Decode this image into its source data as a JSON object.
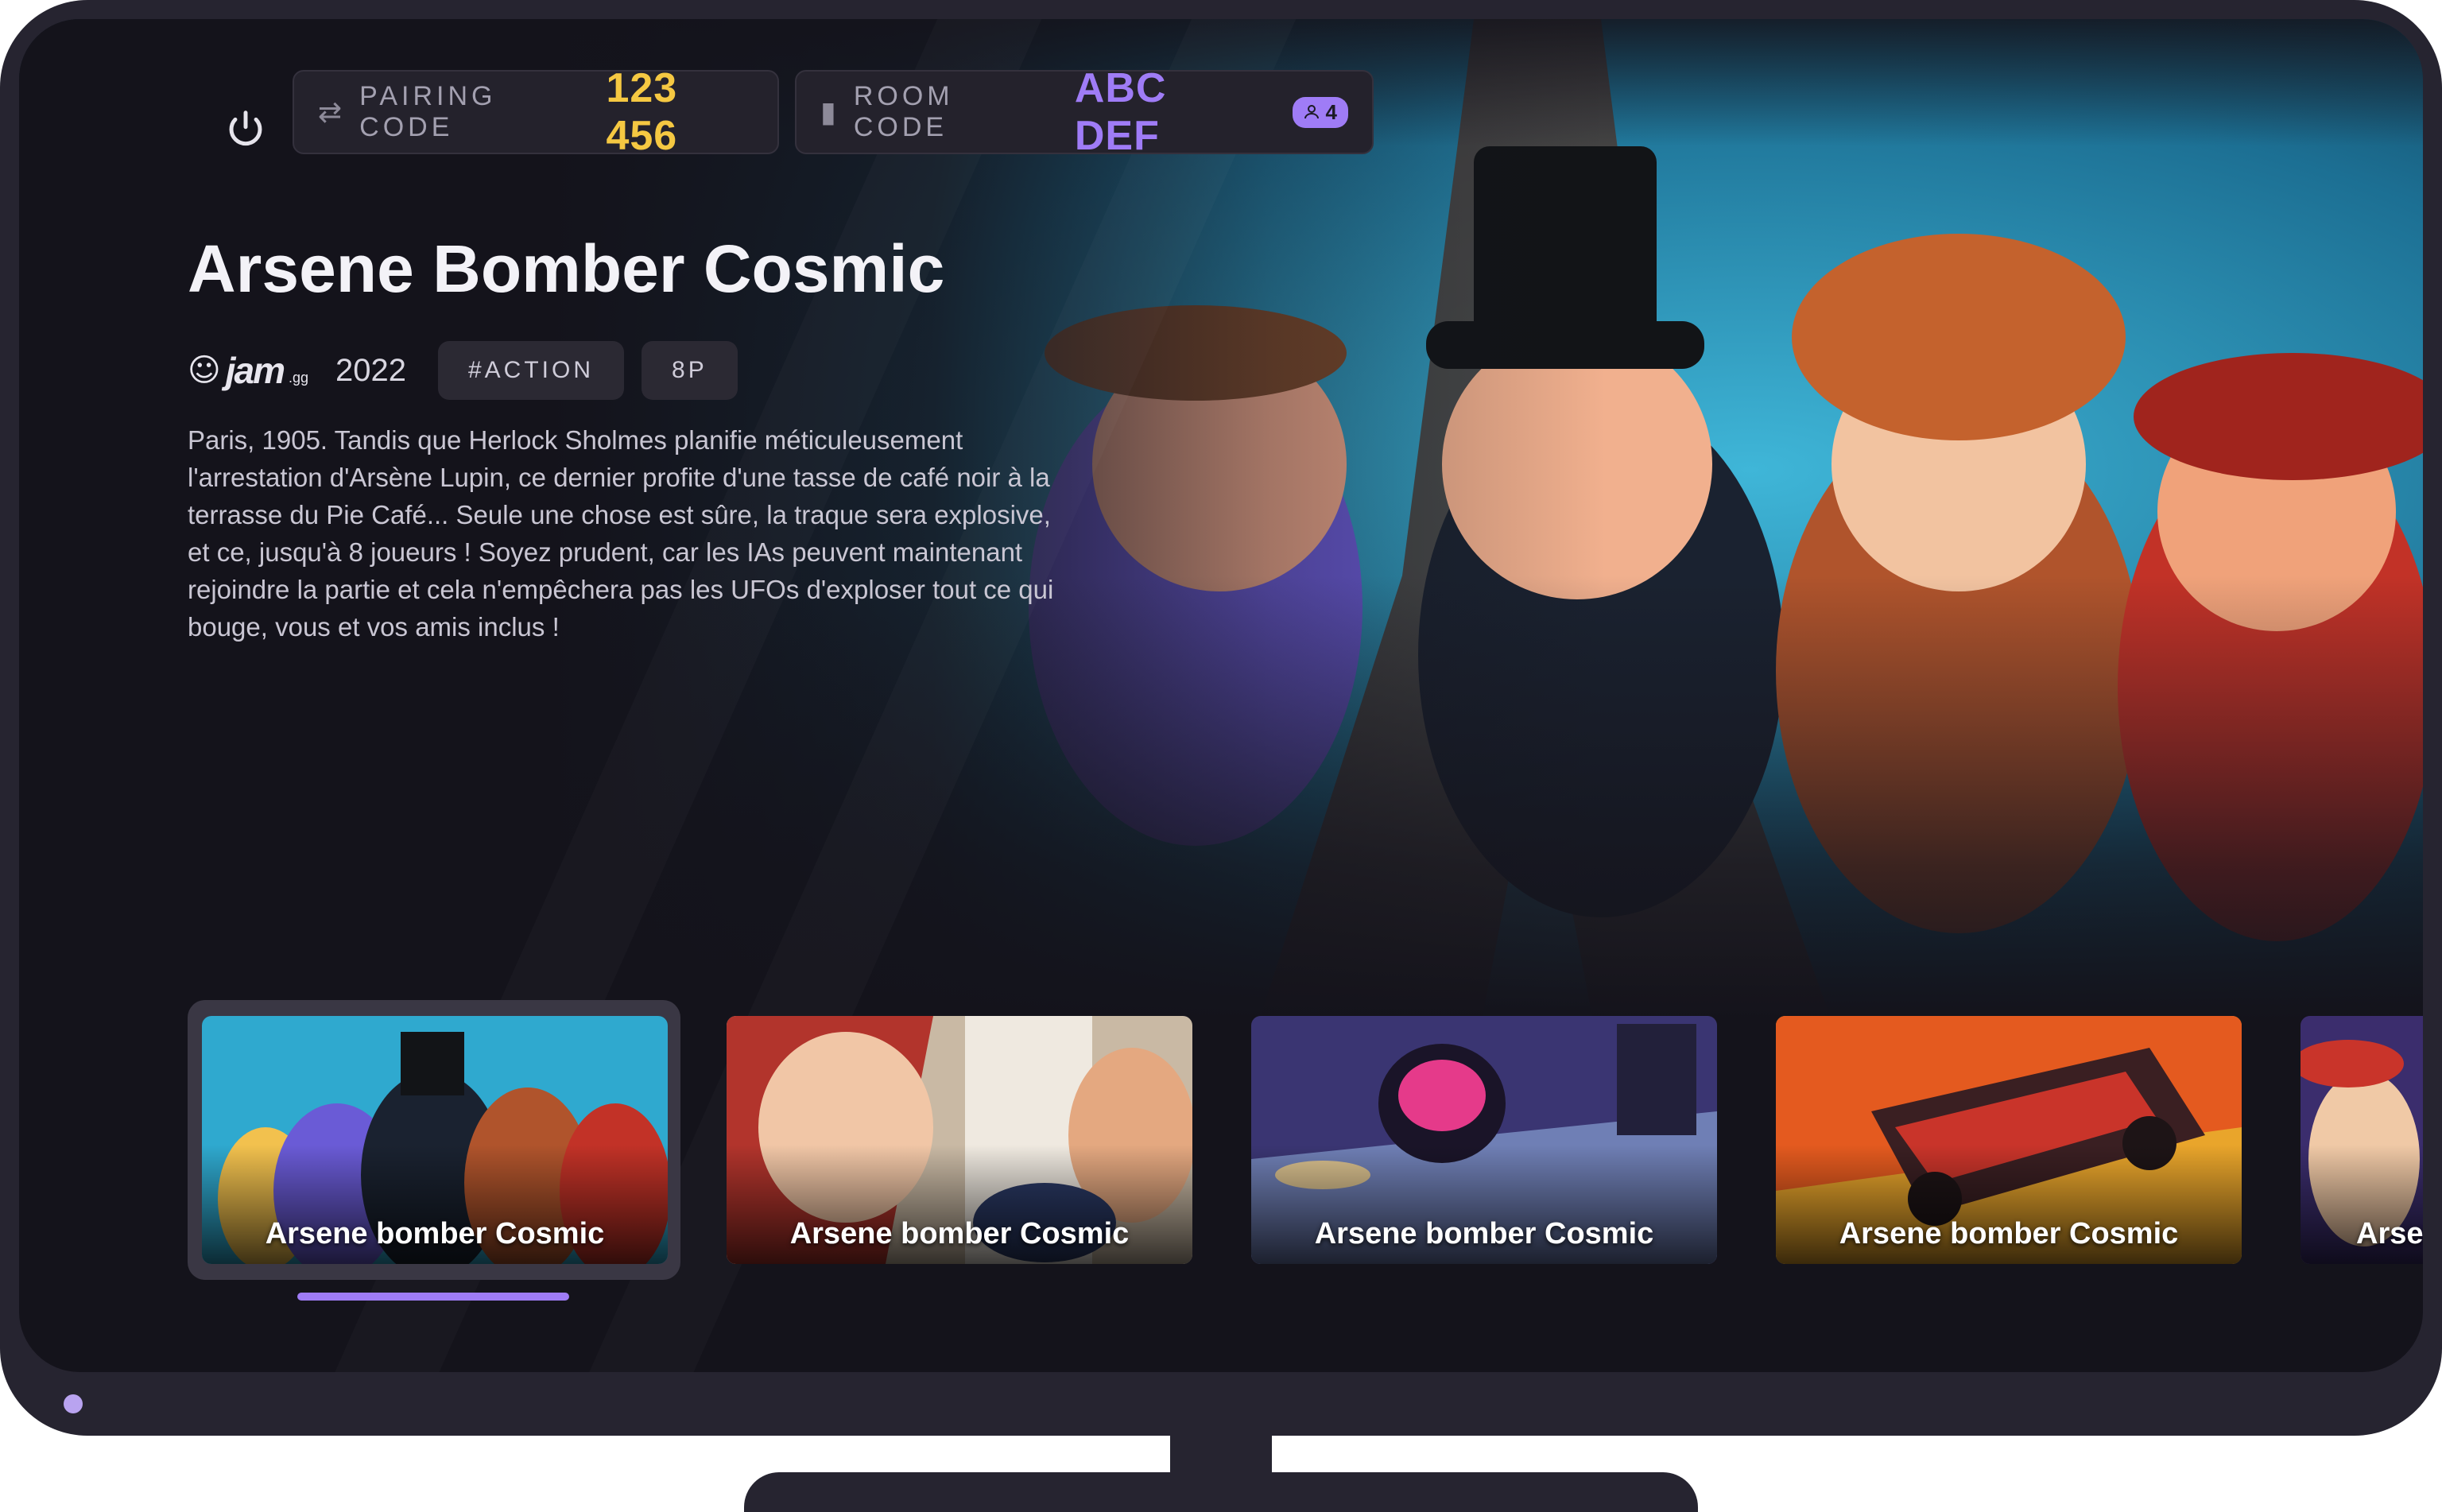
{
  "top_bar": {
    "power_icon": "power-icon",
    "pairing": {
      "icon": "swap-arrows-icon",
      "label": "PAIRING CODE",
      "value": "123 456"
    },
    "room": {
      "icon": "door-icon",
      "label": "ROOM CODE",
      "value": "ABC DEF",
      "players_icon": "user-icon",
      "players_count": "4"
    }
  },
  "game": {
    "title": "Arsene Bomber Cosmic",
    "publisher": {
      "logo_icon": "skull-icon",
      "name": "jam",
      "tld": ".gg"
    },
    "year": "2022",
    "tags": [
      "#ACTION",
      "8P"
    ],
    "description": "Paris, 1905. Tandis que Herlock Sholmes planifie méticuleusement l'arrestation d'Arsène Lupin, ce dernier profite d'une tasse de café noir à la terrasse du Pie Café... Seule une chose est sûre, la traque sera explosive, et ce, jusqu'à 8 joueurs ! Soyez prudent, car les IAs peuvent maintenant rejoindre la partie et cela n'empêchera pas les UFOs d'exploser tout ce qui bouge, vous et vos amis inclus !"
  },
  "carousel": {
    "selected_index": 0,
    "cards": [
      {
        "label": "Arsene bomber Cosmic"
      },
      {
        "label": "Arsene bomber Cosmic"
      },
      {
        "label": "Arsene bomber Cosmic"
      },
      {
        "label": "Arsene bomber Cosmic"
      },
      {
        "label": "Arsene bomber Cosmic"
      }
    ]
  },
  "colors": {
    "accent_purple": "#9f7cf6",
    "accent_yellow": "#f5c842",
    "bezel": "#262430",
    "screen_bg": "#14131b"
  }
}
